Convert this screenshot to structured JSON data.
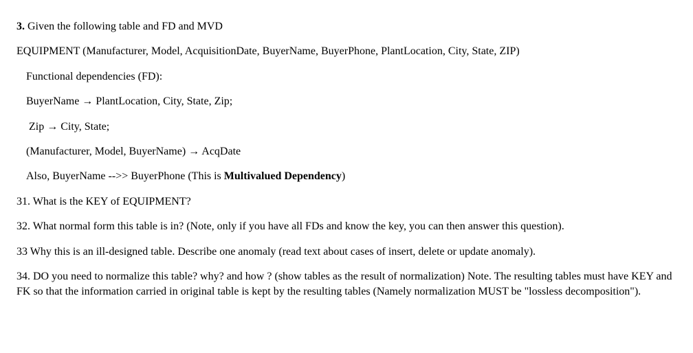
{
  "q3": {
    "number": "3.",
    "text": " Given the following table and FD and MVD"
  },
  "schema": "EQUIPMENT (Manufacturer, Model, AcquisitionDate, BuyerName, BuyerPhone, PlantLocation, City, State, ZIP)",
  "fd_header": "Functional dependencies (FD):",
  "fd1": "BuyerName → PlantLocation, City, State, Zip;",
  "fd2": "Zip → City, State;",
  "fd3": "(Manufacturer, Model, BuyerName) → AcqDate",
  "mvd": {
    "prefix": "Also, BuyerName -->> BuyerPhone (This is ",
    "bold": "Multivalued Dependency",
    "suffix": ")"
  },
  "q31": "31.   What is the KEY of EQUIPMENT?",
  "q32": "32.   What normal form this table is in? (Note, only if you have all FDs and know the key, you can then answer this question).",
  "q33": "33 Why this is an ill-designed table. Describe one anomaly (read text about cases of insert, delete or update anomaly).",
  "q34": "34. DO you need to normalize this table? why? and how ? (show tables as the result of normalization) Note. The resulting tables must have KEY and FK so that the information carried in original table is kept by the resulting tables (Namely normalization MUST be \"lossless decomposition\")."
}
